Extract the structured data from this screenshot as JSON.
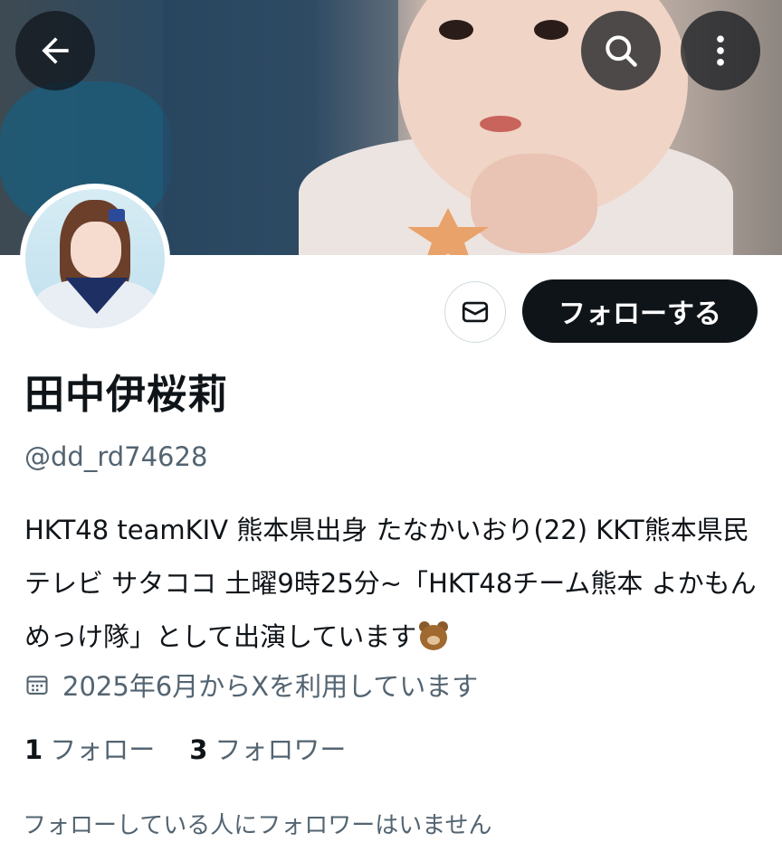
{
  "header": {
    "back_icon": "arrow-left-icon",
    "search_icon": "search-icon",
    "more_icon": "more-vertical-icon"
  },
  "profile": {
    "display_name": "田中伊桜莉",
    "handle": "@dd_rd74628",
    "bio": "HKT48 teamKIV 熊本県出身 たなかいおり(22) KKT熊本県民テレビ サタココ 土曜9時25分~「HKT48チーム熊本 よかもんめっけ隊」として出演しています",
    "bio_emoji": "bear-face",
    "joined": "2025年6月からXを利用しています",
    "joined_icon": "calendar-icon"
  },
  "actions": {
    "message_icon": "mail-icon",
    "follow_label": "フォローする"
  },
  "stats": {
    "following_count": "1",
    "following_label": "フォロー",
    "followers_count": "3",
    "followers_label": "フォロワー"
  },
  "footer": {
    "no_followers_you_know": "フォローしている人にフォロワーはいません"
  },
  "colors": {
    "text_primary": "#0f1419",
    "text_secondary": "#536471",
    "button_dark": "#0f1419",
    "border": "#cfd9de"
  }
}
